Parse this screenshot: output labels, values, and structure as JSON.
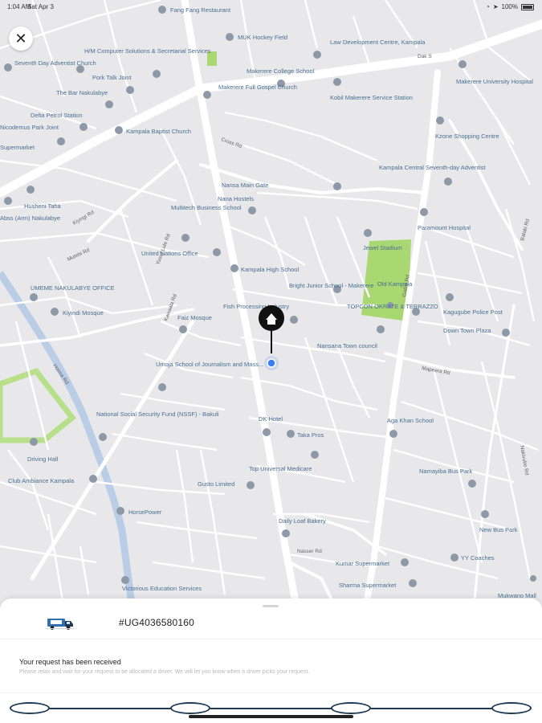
{
  "status_bar": {
    "time": "1:04 AM",
    "date": "Sat Apr 3",
    "battery": "100%"
  },
  "map": {
    "roads": [
      "Kiyingi Rd",
      "Mutebi Rd",
      "Dak S",
      "Cross Rd",
      "Yusuf Lule Rd",
      "Gadaf Rd",
      "Kawaala Rd",
      "Hoima Rd",
      "Mapeera Rd",
      "Balaki Rd",
      "Nasser Rd",
      "Nakivubo Rd"
    ],
    "places": [
      {
        "name": "Fang Fang Restaurant",
        "icon": "restaurant-icon"
      },
      {
        "name": "MUK Hockey Field",
        "icon": "pin-icon"
      },
      {
        "name": "Law Development Centre, Kampala",
        "icon": "pin-icon"
      },
      {
        "name": "Seventh Day Adventist Church",
        "icon": "church-icon"
      },
      {
        "name": "H/M Computer Solutions & Secretarial Services",
        "icon": "pin-icon"
      },
      {
        "name": "Pork Talk Joint",
        "icon": "restaurant-icon"
      },
      {
        "name": "Makerere College School",
        "icon": "school-icon"
      },
      {
        "name": "Makerere University Hospital",
        "icon": "hospital-icon"
      },
      {
        "name": "The Bar Nakulabye",
        "icon": "bar-icon"
      },
      {
        "name": "Makerere Full Gospel Church",
        "icon": "church-icon"
      },
      {
        "name": "Kobil Makerere Service Station",
        "icon": "pin-icon"
      },
      {
        "name": "Delta Petrol Station",
        "icon": "pin-icon"
      },
      {
        "name": "Nicodemus Park Joint",
        "icon": "pin-icon"
      },
      {
        "name": "Kampala Baptist Church",
        "icon": "church-icon"
      },
      {
        "name": "Kzone Shopping Centre",
        "icon": "pin-icon"
      },
      {
        "name": "Supermarket",
        "icon": "pin-icon"
      },
      {
        "name": "Kampala Central Seventh-day Adventist",
        "icon": "church-icon"
      },
      {
        "name": "Nansa Main Gate",
        "icon": "pin-icon"
      },
      {
        "name": "Nana Hostels",
        "icon": "pin-icon"
      },
      {
        "name": "Husheni Taha",
        "icon": "pin-icon"
      },
      {
        "name": "Abss (Arm) Nakulabye",
        "icon": "pin-icon"
      },
      {
        "name": "Multitech Business School",
        "icon": "school-icon"
      },
      {
        "name": "Paramount Hospital",
        "icon": "hospital-icon"
      },
      {
        "name": "Jewel Stadium",
        "icon": "pin-icon"
      },
      {
        "name": "United Nations Office",
        "icon": "pin-icon"
      },
      {
        "name": "Kampala High School",
        "icon": "school-icon"
      },
      {
        "name": "Old Kampala",
        "icon": "pin-icon"
      },
      {
        "name": "UMEME NAKULABYE OFFICE",
        "icon": "pin-icon"
      },
      {
        "name": "Bright Junior School - Makerere",
        "icon": "school-icon"
      },
      {
        "name": "Kiyindi Mosque",
        "icon": "mosque-icon"
      },
      {
        "name": "Fish Processing Industry",
        "icon": "pin-icon"
      },
      {
        "name": "TOPCON OKRATE & TERRAZZO",
        "icon": "pin-icon"
      },
      {
        "name": "Kagugube Police Post",
        "icon": "pin-icon"
      },
      {
        "name": "Faiz Mosque",
        "icon": "mosque-icon"
      },
      {
        "name": "Down Town Plaza",
        "icon": "pin-icon"
      },
      {
        "name": "Nansana Town council",
        "icon": "pin-icon"
      },
      {
        "name": "Umoja School of Journalism and Mass...",
        "icon": "school-icon"
      },
      {
        "name": "National Social Security Fund (NSSF) - Bakuli",
        "icon": "pin-icon"
      },
      {
        "name": "Aga Khan School",
        "icon": "school-icon"
      },
      {
        "name": "DK Hotel",
        "icon": "pin-icon"
      },
      {
        "name": "Taka Pros",
        "icon": "pin-icon"
      },
      {
        "name": "Driving Hall",
        "icon": "pin-icon"
      },
      {
        "name": "Top Universal Medicare",
        "icon": "pin-icon"
      },
      {
        "name": "Namayiba Bus Park",
        "icon": "pin-icon"
      },
      {
        "name": "Club Ambiance Kampala",
        "icon": "pin-icon"
      },
      {
        "name": "Gusto Limited",
        "icon": "pin-icon"
      },
      {
        "name": "HorsePower",
        "icon": "pin-icon"
      },
      {
        "name": "Daily Loaf Bakery",
        "icon": "restaurant-icon"
      },
      {
        "name": "New Bus Park",
        "icon": "pin-icon"
      },
      {
        "name": "Kumar Supermarket",
        "icon": "pin-icon"
      },
      {
        "name": "YY Coaches",
        "icon": "pin-icon"
      },
      {
        "name": "Sharma Supermarket",
        "icon": "pin-icon"
      },
      {
        "name": "Mukwano Mall",
        "icon": "pin-icon"
      },
      {
        "name": "Victorious Education Services",
        "icon": "school-icon"
      }
    ]
  },
  "close_button": {
    "icon": "close-icon"
  },
  "sheet": {
    "vehicle_icon": "delivery-truck-icon",
    "tracking_number": "#UG4036580160",
    "message_title": "Your request has been received",
    "message_body": "Please relax and wait for your request to be allocated a driver. We will let you know when a driver picks your request.",
    "steps": 4,
    "accent_color": "#1e3a55"
  }
}
